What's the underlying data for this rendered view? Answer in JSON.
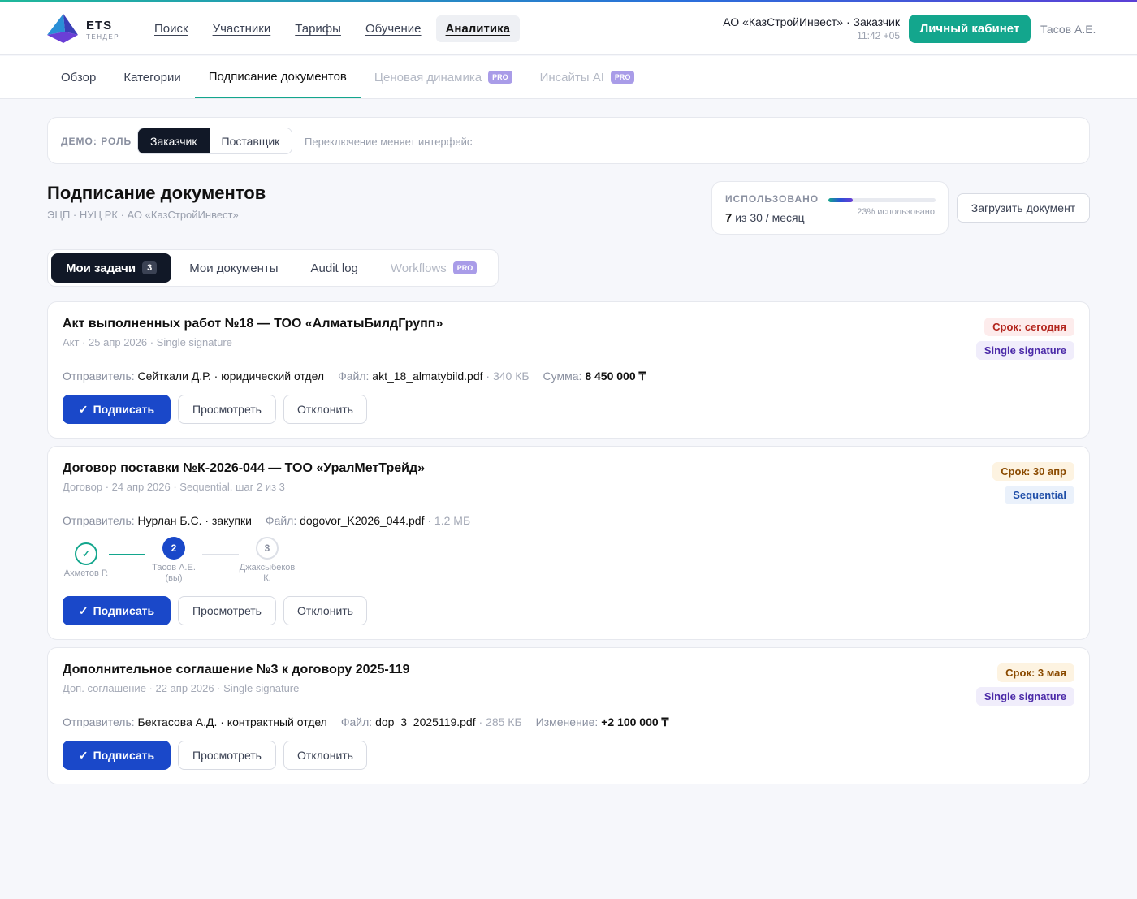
{
  "header": {
    "logo_text": "ETS",
    "logo_sub": "ТЕНДЕР",
    "nav": [
      "Поиск",
      "Участники",
      "Тарифы",
      "Обучение",
      "Аналитика"
    ],
    "active_nav": "Аналитика",
    "company": "АО «КазСтройИнвест» · Заказчик",
    "time": "11:42 +05",
    "cabinet_label": "Личный кабинет",
    "user": "Тасов А.Е."
  },
  "subnav": {
    "tabs": [
      {
        "label": "Обзор"
      },
      {
        "label": "Категории"
      },
      {
        "label": "Подписание документов"
      },
      {
        "label": "Ценовая динамика",
        "badge": "PRO"
      },
      {
        "label": "Инсайты AI",
        "badge": "PRO"
      }
    ]
  },
  "role": {
    "label": "ДЕМО: РОЛЬ",
    "options": [
      "Заказчик",
      "Поставщик"
    ],
    "selected": "Заказчик",
    "hint": "Переключение меняет интерфейс"
  },
  "page": {
    "title": "Подписание документов",
    "subtitle": "ЭЦП · НУЦ РК · АО «КазСтройИнвест»"
  },
  "usage": {
    "label": "ИСПОЛЬЗОВАНО",
    "used": "7",
    "rest": "из 30 / месяц",
    "fraction": 0.23,
    "pct_text": "23% использовано"
  },
  "upload_label": "Загрузить документ",
  "tabs": [
    {
      "label": "Мои задачи",
      "count": "3"
    },
    {
      "label": "Мои документы"
    },
    {
      "label": "Audit log"
    },
    {
      "label": "Workflows",
      "badge": "PRO"
    }
  ],
  "buttons": {
    "sign": "Подписать",
    "view": "Просмотреть",
    "reject": "Отклонить"
  },
  "docs": [
    {
      "title": "Акт выполненных работ №18 — ТОО «АлматыБилдГрупп»",
      "meta": "Акт · 25 апр 2026 · Single signature",
      "due": "Срок: сегодня",
      "flow": "Single signature",
      "sender_label": "Отправитель:",
      "sender": "Сейткали Д.Р. · юридический отдел",
      "file_label": "Файл:",
      "file": "akt_18_almatybild.pdf",
      "size": "· 340 КБ",
      "extra_label": "Сумма:",
      "extra": "8 450 000 ₸"
    },
    {
      "title": "Договор поставки №К-2026-044 — ТОО «УралМетТрейд»",
      "meta": "Договор · 24 апр 2026 · Sequential, шаг 2 из 3",
      "due": "Срок: 30 апр",
      "flow": "Sequential",
      "sender_label": "Отправитель:",
      "sender": "Нурлан Б.С. · закупки",
      "file_label": "Файл:",
      "file": "dogovor_K2026_044.pdf",
      "size": "· 1.2 МБ",
      "steps": [
        {
          "mark": "✓",
          "label": "Ахметов Р."
        },
        {
          "mark": "2",
          "label": "Тасов А.Е. (вы)"
        },
        {
          "mark": "3",
          "label": "Джаксыбеков К."
        }
      ]
    },
    {
      "title": "Дополнительное соглашение №3 к договору 2025-119",
      "meta": "Доп. соглашение · 22 апр 2026 · Single signature",
      "due": "Срок: 3 мая",
      "flow": "Single signature",
      "sender_label": "Отправитель:",
      "sender": "Бектасова А.Д. · контрактный отдел",
      "file_label": "Файл:",
      "file": "dop_3_2025119.pdf",
      "size": "· 285 КБ",
      "extra_label": "Изменение:",
      "extra": "+2 100 000 ₸"
    }
  ],
  "colors": {
    "accent": "#13a68d",
    "primary": "#1a48c9",
    "dark": "#111827"
  }
}
